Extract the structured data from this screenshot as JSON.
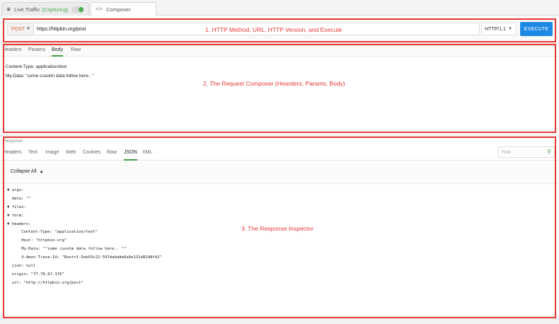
{
  "tabs": {
    "live_label": "Live Traffic",
    "live_status": "(Capturing)",
    "composer_label": "Composer"
  },
  "request": {
    "method": "POST",
    "url": "https://httpbin.org/post",
    "http_version": "HTTP/1.1",
    "execute_label": "EXECUTE"
  },
  "composer": {
    "tabs": [
      "Headers",
      "Params",
      "Body",
      "Raw"
    ],
    "active_tab": "Body",
    "body_lines": [
      "Content-Type: application/text",
      "My-Data: \"some cusotm data follow here.. \""
    ]
  },
  "response": {
    "label": "Response",
    "tabs": [
      "Headers",
      "Text",
      "Image",
      "Web",
      "Cookies",
      "Raw",
      "JSON",
      "XML"
    ],
    "active_tab": "JSON",
    "find_placeholder": "Find",
    "collapse_label": "Collapse All",
    "json_lines": [
      "▼ args:",
      "  data: \"\"",
      "▼ files:",
      "▼ form:",
      "▼ headers:",
      "      Content-Type: \"application/text\"",
      "      Host: \"httpbin.org\"",
      "      My-Data: \"\"some cusotm data follow here.. \"\"",
      "      X-Amzn-Trace-Id: \"Root=1-5eb93c22-597dabdde6a9e131d8248f42\"",
      "  json: null",
      "  origin: \"77.70.67.176\"",
      "  url: \"http://httpbin.org/post\""
    ]
  },
  "annotations": {
    "one": "1. HTTP Method, URL, HTTP Version, and Execute",
    "two": "2. The Request Composer (Hearders, Params, Body)",
    "three": "3. The Response Inspector"
  },
  "colors": {
    "annotation": "#e53935",
    "execute": "#1e88e5",
    "active_tab": "#43a047",
    "method": "#e06a2f"
  },
  "icons": [
    "eye-icon",
    "code-icon",
    "chevron-down-icon",
    "chevron-up-icon",
    "search-icon",
    "triangle-down-icon"
  ]
}
